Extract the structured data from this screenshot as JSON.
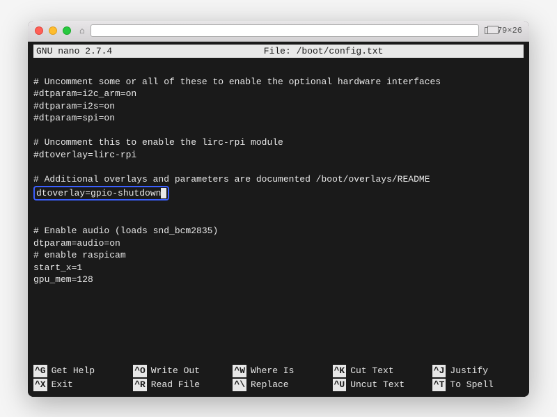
{
  "titlebar": {
    "window_size": "79×26"
  },
  "editor": {
    "app_version": "GNU nano 2.7.4",
    "file_label": "File: /boot/config.txt"
  },
  "content": {
    "line1": "# Uncomment some or all of these to enable the optional hardware interfaces",
    "line2": "#dtparam=i2c_arm=on",
    "line3": "#dtparam=i2s=on",
    "line4": "#dtparam=spi=on",
    "line5": "",
    "line6": "# Uncomment this to enable the lirc-rpi module",
    "line7": "#dtoverlay=lirc-rpi",
    "line8": "",
    "line9": "# Additional overlays and parameters are documented /boot/overlays/README",
    "line10": "dtoverlay=gpio-shutdown",
    "line11": "",
    "line12": "",
    "line13": "# Enable audio (loads snd_bcm2835)",
    "line14": "dtparam=audio=on",
    "line15": "# enable raspicam",
    "line16": "start_x=1",
    "line17": "gpu_mem=128"
  },
  "help": {
    "k1": "^G",
    "l1": "Get Help",
    "k2": "^O",
    "l2": "Write Out",
    "k3": "^W",
    "l3": "Where Is",
    "k4": "^K",
    "l4": "Cut Text",
    "k5": "^J",
    "l5": "Justify",
    "k6": "^X",
    "l6": "Exit",
    "k7": "^R",
    "l7": "Read File",
    "k8": "^\\",
    "l8": "Replace",
    "k9": "^U",
    "l9": "Uncut Text",
    "k10": "^T",
    "l10": "To Spell"
  }
}
